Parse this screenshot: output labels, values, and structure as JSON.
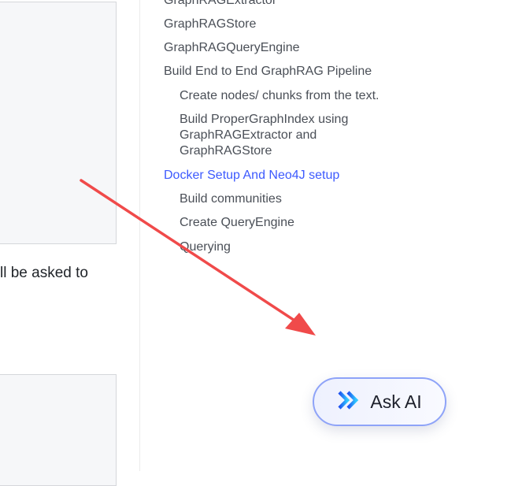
{
  "content": {
    "paragraph_fragment": "ll be asked to"
  },
  "toc": {
    "items": [
      {
        "label": "GraphRAGExtractor",
        "level": 1,
        "active": false
      },
      {
        "label": "GraphRAGStore",
        "level": 1,
        "active": false
      },
      {
        "label": "GraphRAGQueryEngine",
        "level": 1,
        "active": false
      },
      {
        "label": "Build End to End GraphRAG Pipeline",
        "level": 1,
        "active": false
      },
      {
        "label": "Create nodes/ chunks from the text.",
        "level": 2,
        "active": false
      },
      {
        "label": "Build ProperGraphIndex using GraphRAGExtractor and GraphRAGStore",
        "level": 2,
        "active": false
      },
      {
        "label": "Docker Setup And Neo4J setup",
        "level": 1,
        "active": true
      },
      {
        "label": "Build communities",
        "level": 2,
        "active": false
      },
      {
        "label": "Create QueryEngine",
        "level": 2,
        "active": false
      },
      {
        "label": "Querying",
        "level": 2,
        "active": false
      }
    ]
  },
  "ask_ai": {
    "label": "Ask AI",
    "icon": "chevrons-right-icon"
  },
  "colors": {
    "accent": "#3d5afe",
    "annotation_arrow": "#f04a4a",
    "button_border": "#8ea3f8"
  }
}
